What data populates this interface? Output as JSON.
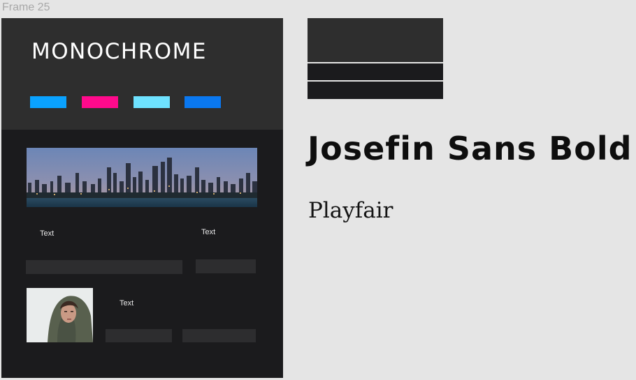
{
  "canvas": {
    "frame_label": "Frame 25"
  },
  "mockup": {
    "brand": "MONOCHROME",
    "palette": [
      {
        "name": "sky-blue",
        "color": "#0aa2ff"
      },
      {
        "name": "hot-pink",
        "color": "#ff0a8c"
      },
      {
        "name": "light-cyan",
        "color": "#6ee2ff"
      },
      {
        "name": "royal-blue",
        "color": "#0a78f0"
      }
    ],
    "hero_image": "city-skyline-at-dusk",
    "text_left": "Text",
    "text_right": "Text",
    "portrait_image": "woman-in-hood-portrait",
    "text_portrait": "Text"
  },
  "color_blocks": [
    {
      "name": "charcoal",
      "color": "#2e2e2e"
    },
    {
      "name": "near-black",
      "color": "#1b1b1d"
    },
    {
      "name": "near-black",
      "color": "#1b1b1d"
    }
  ],
  "typography": {
    "heading_sample": "Josefin Sans Bold",
    "body_sample": "Playfair"
  }
}
